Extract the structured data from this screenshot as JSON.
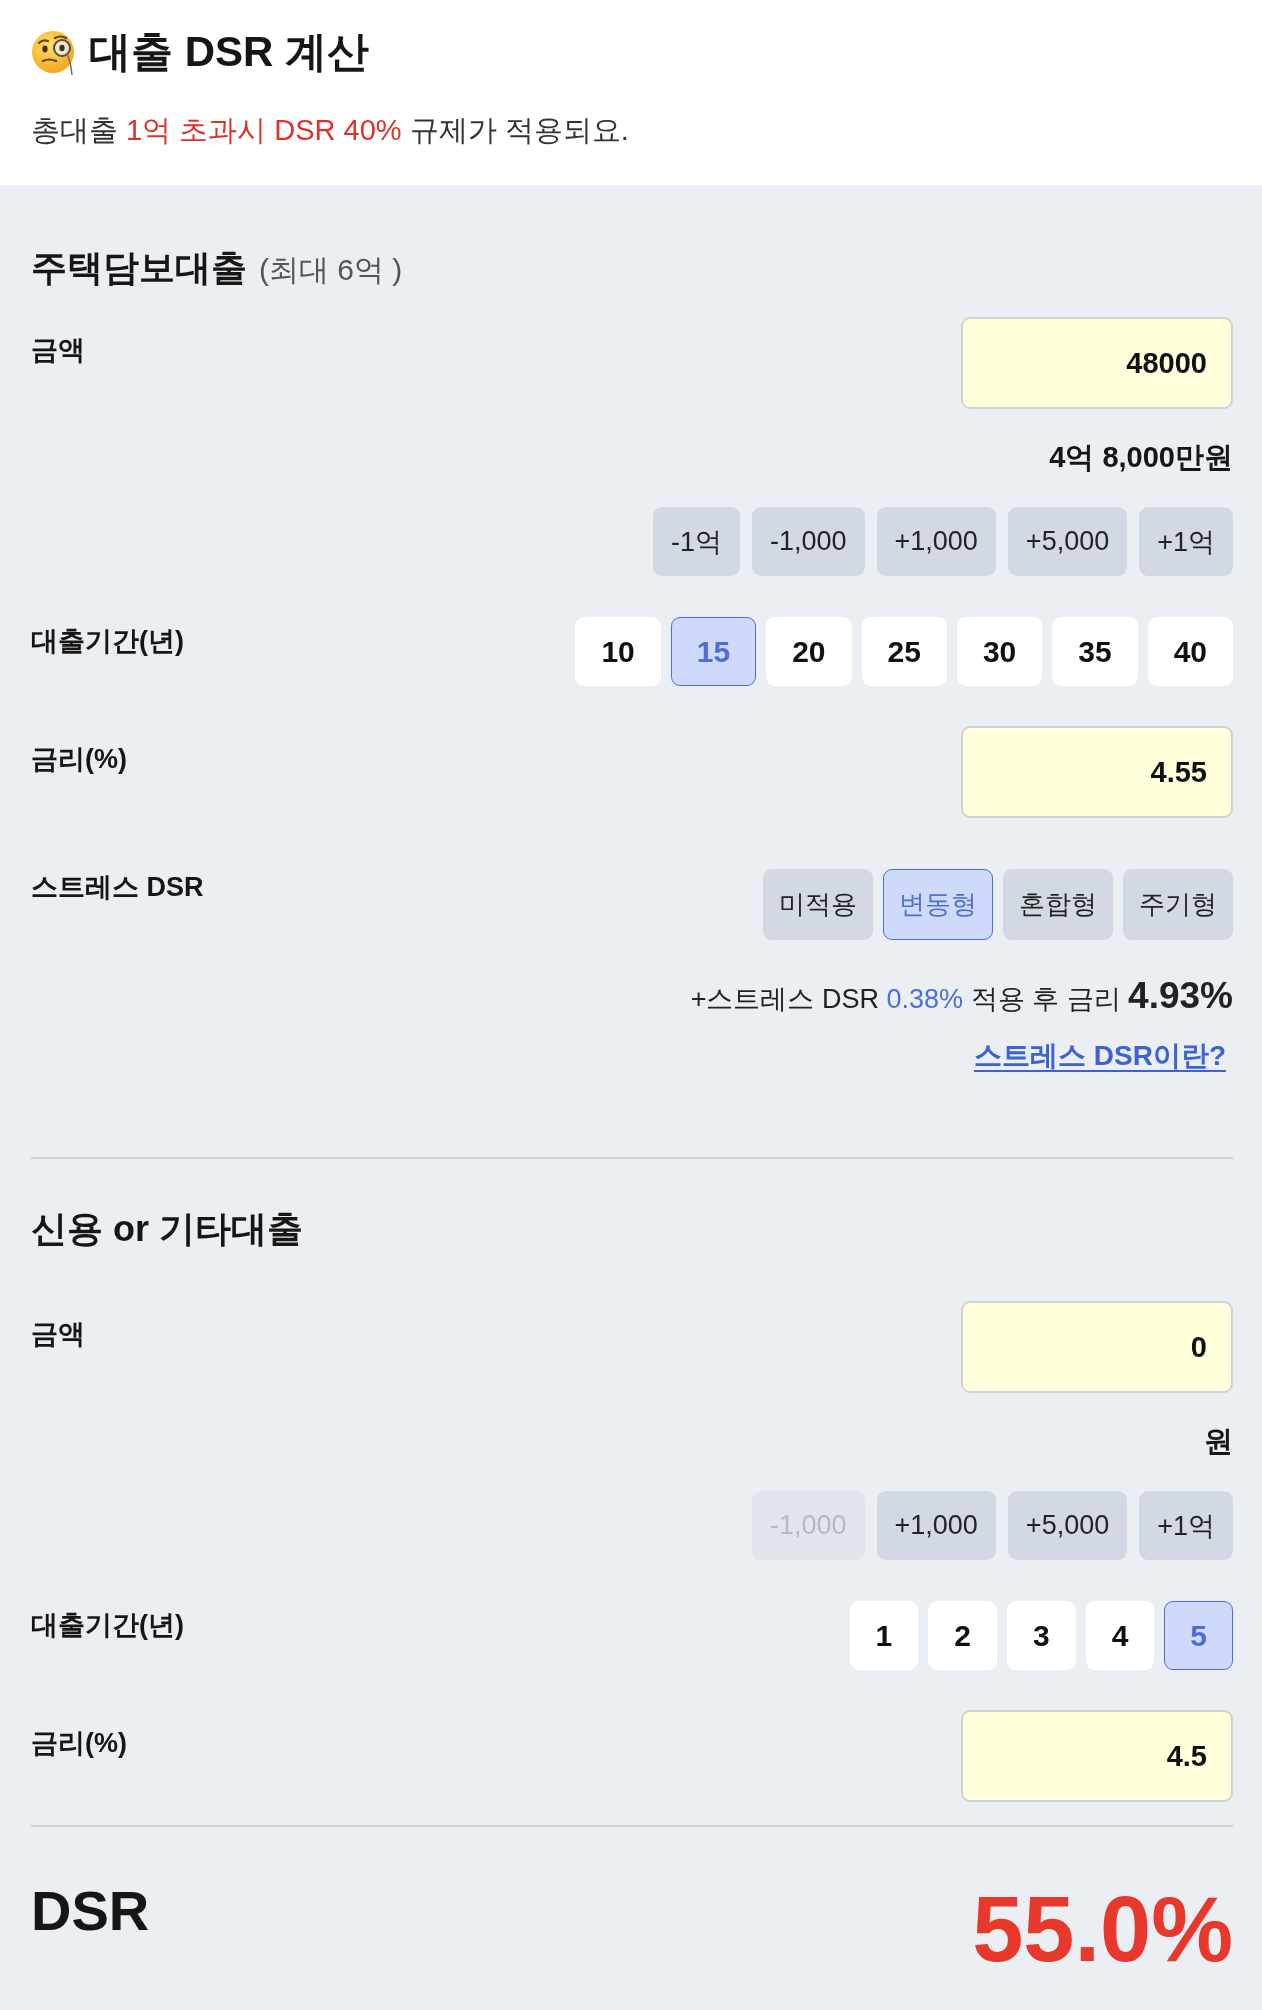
{
  "header": {
    "title": "대출 DSR 계산",
    "notice": [
      {
        "kind": "plain",
        "text": "총대출 "
      },
      {
        "kind": "highlight",
        "text": "1억 초과시 DSR 40%"
      },
      {
        "kind": "plain",
        "text": " 규제가 적용되요."
      }
    ]
  },
  "sections": [
    {
      "title": "주택담보대출",
      "limit": "(최대 6억 )",
      "amount": {
        "label": "금액",
        "value": "48000",
        "formatted": "4억 8,000만원",
        "adjust_buttons": [
          {
            "label": "-1억",
            "disabled": false
          },
          {
            "label": "-1,000",
            "disabled": false
          },
          {
            "label": "+1,000",
            "disabled": false
          },
          {
            "label": "+5,000",
            "disabled": false
          },
          {
            "label": "+1억",
            "disabled": false
          }
        ]
      },
      "term": {
        "label": "대출기간(년)",
        "options": [
          {
            "label": "10",
            "selected": false
          },
          {
            "label": "15",
            "selected": true
          },
          {
            "label": "20",
            "selected": false
          },
          {
            "label": "25",
            "selected": false
          },
          {
            "label": "30",
            "selected": false
          },
          {
            "label": "35",
            "selected": false
          },
          {
            "label": "40",
            "selected": false
          }
        ]
      },
      "rate": {
        "label": "금리(%)",
        "value": "4.55"
      },
      "stress": {
        "label": "스트레스 DSR",
        "options": [
          {
            "label": "미적용",
            "selected": false
          },
          {
            "label": "변동형",
            "selected": true
          },
          {
            "label": "혼합형",
            "selected": false
          },
          {
            "label": "주기형",
            "selected": false
          }
        ],
        "summary": [
          {
            "kind": "plain",
            "text": "+스트레스 DSR "
          },
          {
            "kind": "accent",
            "text": "0.38%"
          },
          {
            "kind": "plain",
            "text": " 적용 후 금리 "
          },
          {
            "kind": "strong",
            "text": "4.93%"
          }
        ],
        "link": "스트레스 DSR이란?"
      }
    },
    {
      "title": "신용 or 기타대출",
      "amount": {
        "label": "금액",
        "value": "0",
        "formatted": "원",
        "adjust_buttons": [
          {
            "label": "-1,000",
            "disabled": true
          },
          {
            "label": "+1,000",
            "disabled": false
          },
          {
            "label": "+5,000",
            "disabled": false
          },
          {
            "label": "+1억",
            "disabled": false
          }
        ]
      },
      "term": {
        "label": "대출기간(년)",
        "options": [
          {
            "label": "1",
            "selected": false
          },
          {
            "label": "2",
            "selected": false
          },
          {
            "label": "3",
            "selected": false
          },
          {
            "label": "4",
            "selected": false
          },
          {
            "label": "5",
            "selected": true
          }
        ]
      },
      "rate": {
        "label": "금리(%)",
        "value": "4.5"
      }
    }
  ],
  "result": {
    "label": "DSR",
    "value": "55.0%"
  }
}
